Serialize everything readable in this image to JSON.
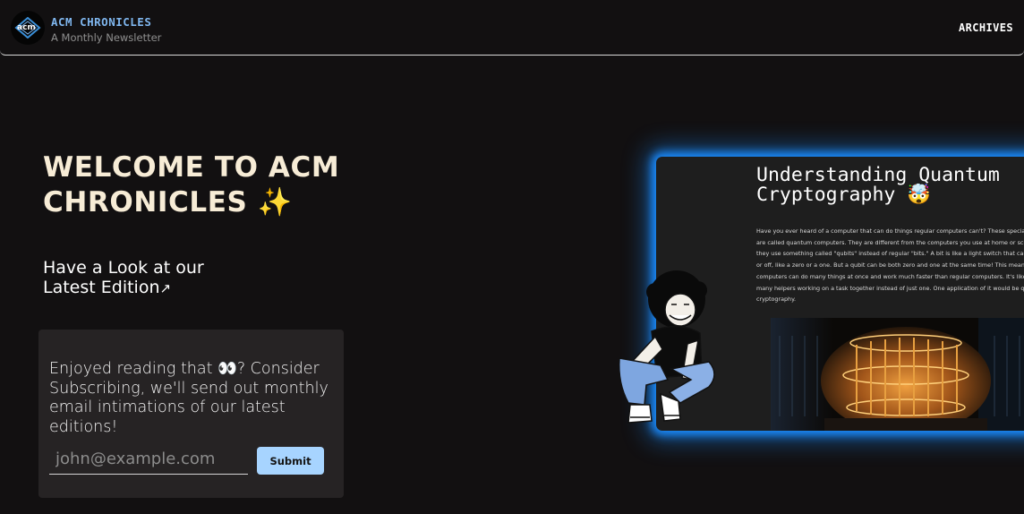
{
  "header": {
    "logo_text": "acm",
    "title": "ACM CHRONICLES",
    "subtitle": "A Monthly Newsletter",
    "nav_archives": "ARCHIVES"
  },
  "hero": {
    "title_line1": "WELCOME TO ACM",
    "title_line2": "CHRONICLES",
    "title_emoji": "✨",
    "latest_line1": "Have a Look at our",
    "latest_line2": "Latest Edition",
    "latest_arrow": "↗"
  },
  "subscribe": {
    "text": "Enjoyed reading that 👀? Consider Subscribing, we'll send out monthly email intimations of our latest editions!",
    "email_placeholder": "john@example.com",
    "submit_label": "Submit"
  },
  "preview": {
    "title_line1": "Understanding Quantum",
    "title_line2": "Cryptography 🤯",
    "body_lines": [
      "Have you ever heard of a computer that can do things regular computers can't? These special com",
      "are called quantum computers. They are different from the computers you use at home or school",
      "they use something called \"qubits\" instead of regular \"bits.\" A bit is like a light switch that can only",
      "or off, like a zero or a one. But a qubit can be both zero and one at the same time! This means qu",
      "computers can do many things at once and work much faster than regular computers. It's like hav",
      "many helpers working on a task together instead of just one. One application of it would be quant",
      "cryptography."
    ]
  },
  "colors": {
    "background": "#121011",
    "brand_blue": "#7fb6ee",
    "hero_title": "#f7ecd6",
    "card_bg": "#262324",
    "submit_bg": "#a7d4ff",
    "glow": "#1a8cff"
  },
  "icons": {
    "logo": "acm-logo-icon",
    "arrow": "arrow-up-right-icon",
    "character": "crouching-person-illustration"
  }
}
